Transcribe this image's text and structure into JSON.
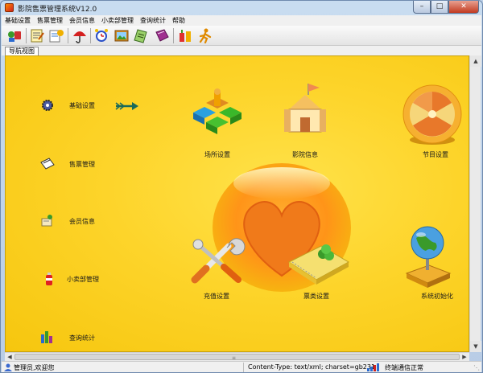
{
  "window": {
    "title": "影院售票管理系统V12.0"
  },
  "menu": [
    "基础设置",
    "售票管理",
    "会员信息",
    "小卖部管理",
    "查询统计",
    "帮助"
  ],
  "tab": {
    "label": "导航视图"
  },
  "sidebar": [
    {
      "label": "基础设置",
      "icon": "gear-icon"
    },
    {
      "label": "售票管理",
      "icon": "ticket-icon"
    },
    {
      "label": "会员信息",
      "icon": "members-icon"
    },
    {
      "label": "小卖部管理",
      "icon": "snack-icon"
    },
    {
      "label": "查询统计",
      "icon": "bar-chart-icon"
    }
  ],
  "tiles": [
    {
      "label": "场所设置",
      "icon": "venue-blocks-icon"
    },
    {
      "label": "影院信息",
      "icon": "cinema-building-icon"
    },
    {
      "label": "节目设置",
      "icon": "program-disc-icon"
    },
    {
      "label": "充值设置",
      "icon": "tools-icon"
    },
    {
      "label": "票类设置",
      "icon": "ticket-book-icon"
    },
    {
      "label": "系统初始化",
      "icon": "globe-icon"
    }
  ],
  "status": {
    "user": "管理员,欢迎您",
    "content_type": "Content-Type: text/xml; charset=gb231",
    "connection": "终端通信正常"
  },
  "colors": {
    "content_bg": "#fdd42a",
    "accent_orange": "#ff8a00"
  }
}
